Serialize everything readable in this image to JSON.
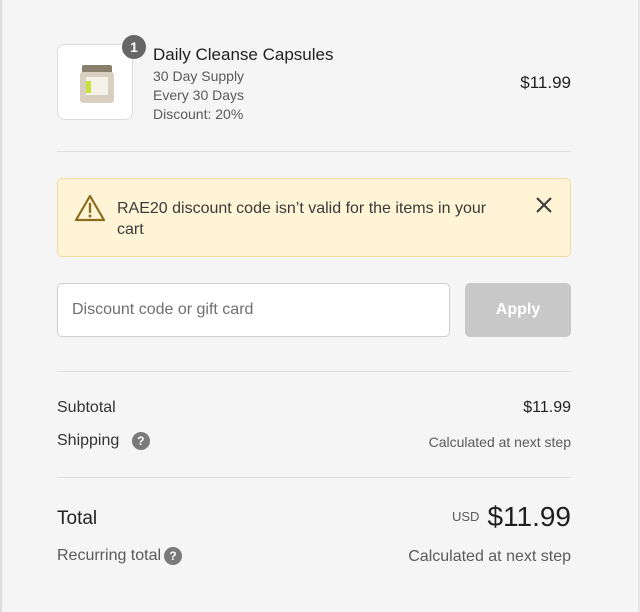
{
  "product": {
    "quantity": "1",
    "name": "Daily Cleanse Capsules",
    "supply": "30 Day Supply",
    "frequency": "Every 30 Days",
    "discount": "Discount: 20%",
    "price": "$11.99",
    "image_icon": "supplement-jar"
  },
  "alert": {
    "message": "RAE20 discount code isn’t valid for the items in your cart",
    "icon": "warning-triangle",
    "close_icon": "close",
    "background": "#fff4d6",
    "icon_color": "#8a6d1c"
  },
  "discount": {
    "placeholder": "Discount code or gift card",
    "value": "",
    "apply_label": "Apply"
  },
  "summary": {
    "subtotal_label": "Subtotal",
    "subtotal_value": "$11.99",
    "shipping_label": "Shipping",
    "shipping_value": "Calculated at next step",
    "help_icon": "?",
    "total_label": "Total",
    "currency": "USD",
    "total_value": "$11.99",
    "recurring_label": "Recurring total",
    "recurring_value": "Calculated at next step"
  }
}
